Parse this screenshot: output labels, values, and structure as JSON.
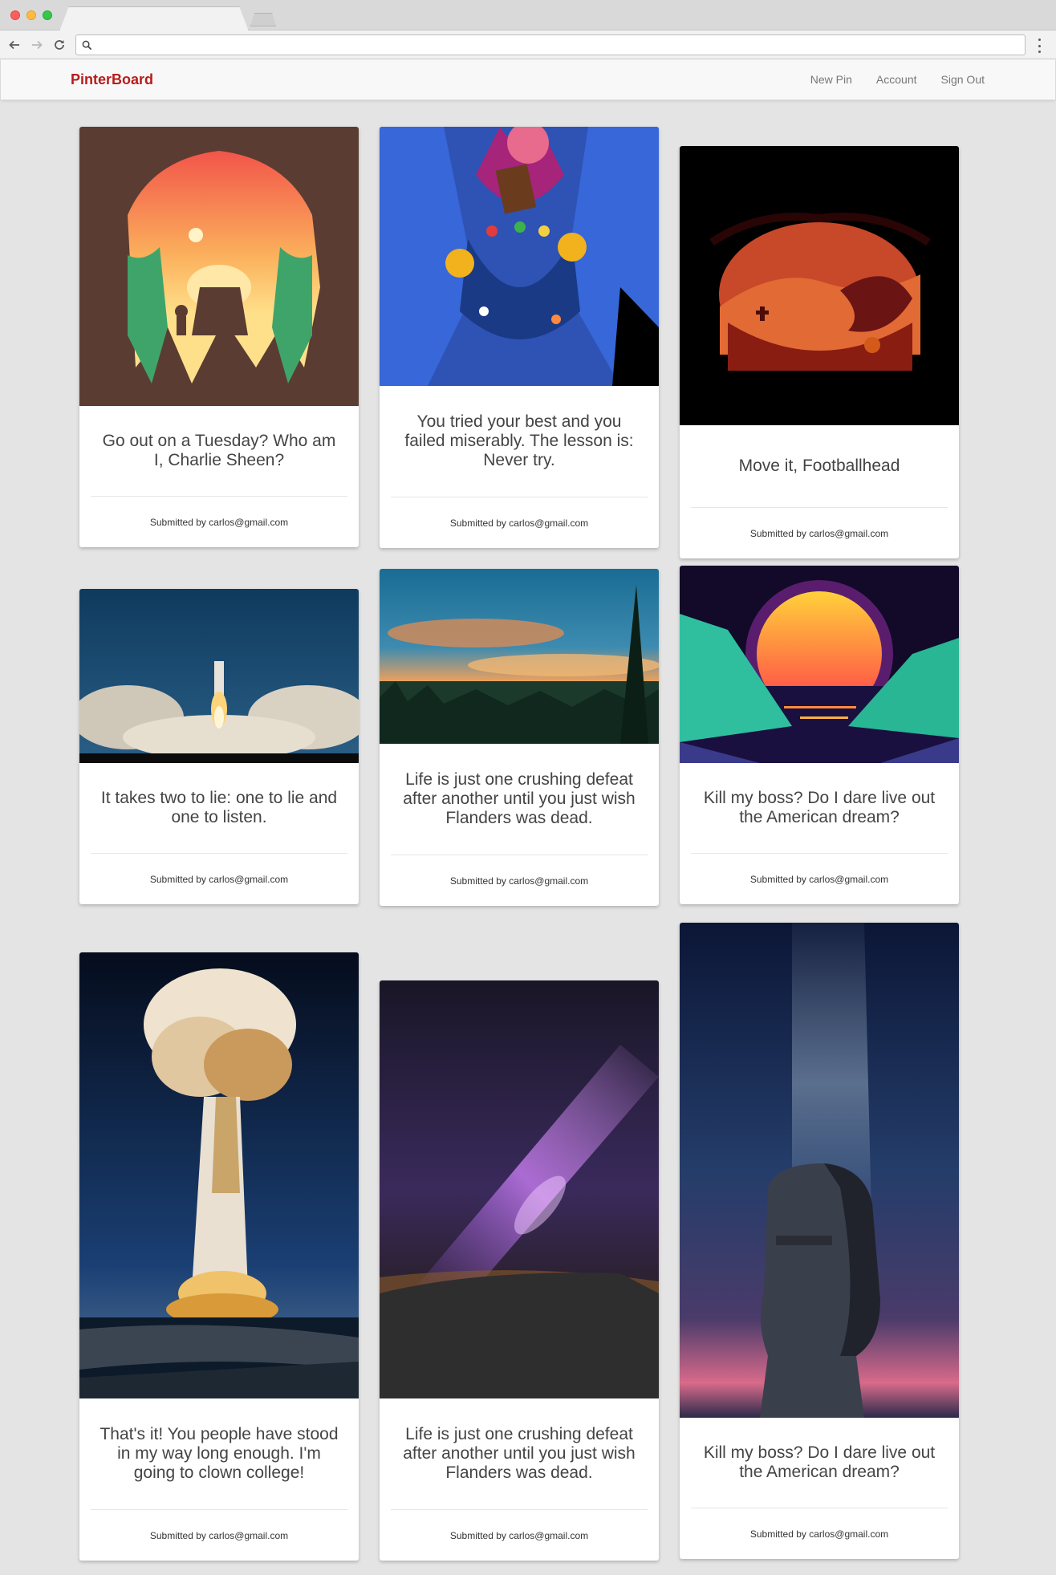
{
  "browser": {
    "url": ""
  },
  "navbar": {
    "brand": "PinterBoard",
    "links": [
      "New Pin",
      "Account",
      "Sign Out"
    ]
  },
  "pins": [
    {
      "caption": "Go out on a Tuesday? Who am I, Charlie Sheen?",
      "submitted_by": "Submitted by carlos@gmail.com",
      "image": "forest-sunset-silhouette-illustration"
    },
    {
      "caption": "You tried your best and you failed miserably. The lesson is: Never try.",
      "submitted_by": "Submitted by carlos@gmail.com",
      "image": "candy-overflow-illustration"
    },
    {
      "caption": "Move it, Footballhead",
      "submitted_by": "Submitted by carlos@gmail.com",
      "image": "halloween-pumpkin-hill-illustration"
    },
    {
      "caption": "It takes two to lie: one to lie and one to listen.",
      "submitted_by": "Submitted by carlos@gmail.com",
      "image": "shuttle-launch-photo"
    },
    {
      "caption": "Life is just one crushing defeat after another until you just wish Flanders was dead.",
      "submitted_by": "Submitted by carlos@gmail.com",
      "image": "forest-sky-sunset-photo"
    },
    {
      "caption": "Kill my boss? Do I dare live out the American dream?",
      "submitted_by": "Submitted by carlos@gmail.com",
      "image": "retro-synthwave-sunset-illustration"
    },
    {
      "caption": "That's it! You people have stood in my way long enough. I'm going to clown college!",
      "submitted_by": "Submitted by carlos@gmail.com",
      "image": "mushroom-cloud-photo"
    },
    {
      "caption": "Life is just one crushing defeat after another until you just wish Flanders was dead.",
      "submitted_by": "Submitted by carlos@gmail.com",
      "image": "milky-way-night-sky-photo"
    },
    {
      "caption": "Kill my boss? Do I dare live out the American dream?",
      "submitted_by": "Submitted by carlos@gmail.com",
      "image": "moai-under-stars-photo"
    }
  ]
}
